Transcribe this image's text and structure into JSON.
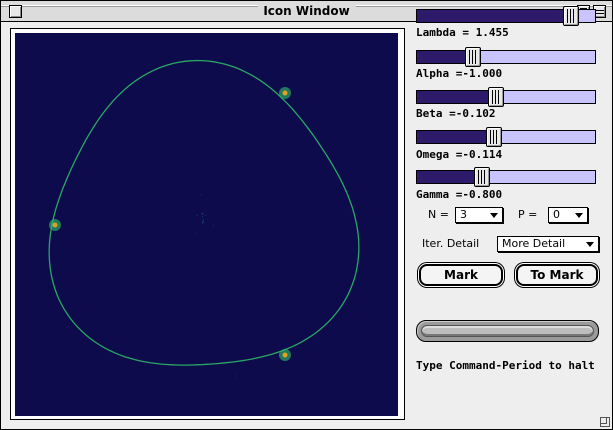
{
  "window": {
    "title": "Icon Window"
  },
  "colors": {
    "canvas_background": "#0e0b4d",
    "attractor_primary": "#1f7fa8",
    "attractor_bright": "#2fc26a",
    "hotspot": "#e0a020",
    "slider_fill": "#2e1a6b",
    "slider_track": "#c9c4ff"
  },
  "sliders": [
    {
      "label": "Lambda = 1.455",
      "fraction": 0.87
    },
    {
      "label": "Alpha =-1.000",
      "fraction": 0.32
    },
    {
      "label": "Beta =-0.102",
      "fraction": 0.45
    },
    {
      "label": "Omega =-0.114",
      "fraction": 0.44
    },
    {
      "label": "Gamma =-0.800",
      "fraction": 0.37
    }
  ],
  "controls": {
    "n_label": "N =",
    "n_value": "3",
    "p_label": "P =",
    "p_value": "0",
    "iter_label": "Iter. Detail",
    "iter_value": "More Detail"
  },
  "buttons": {
    "mark": "Mark",
    "to_mark": "To Mark"
  },
  "status": "Type Command-Period to halt"
}
